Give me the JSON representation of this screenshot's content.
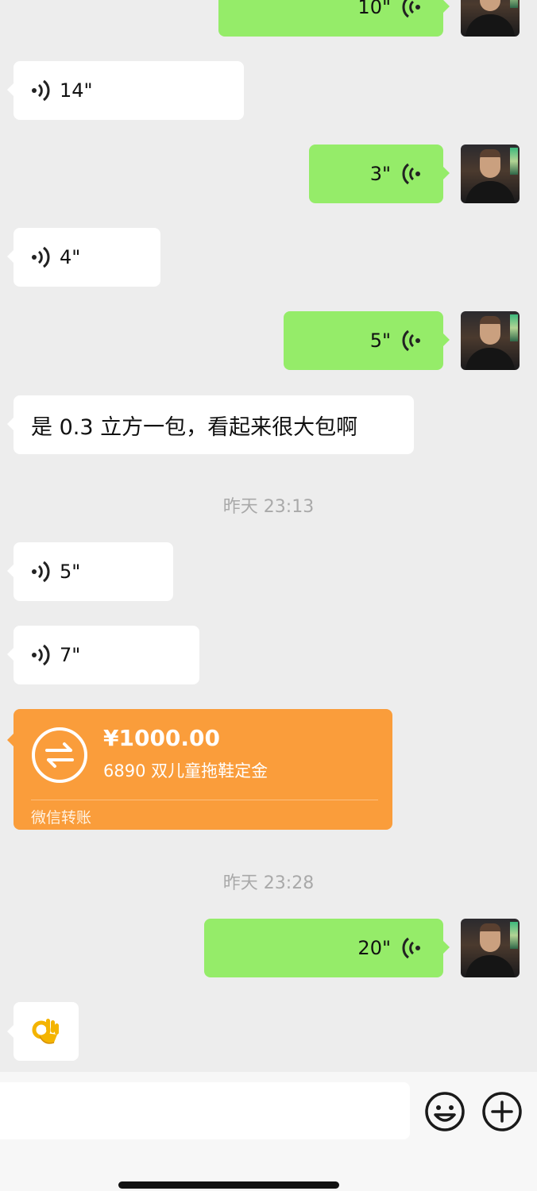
{
  "messages": [
    {
      "type": "voice",
      "side": "right",
      "duration": "10\""
    },
    {
      "type": "voice",
      "side": "left",
      "duration": "14\""
    },
    {
      "type": "voice",
      "side": "right",
      "duration": "3\""
    },
    {
      "type": "voice",
      "side": "left",
      "duration": "4\""
    },
    {
      "type": "voice",
      "side": "right",
      "duration": "5\""
    },
    {
      "type": "text",
      "side": "left",
      "text": "是 0.3 立方一包，看起来很大包啊"
    },
    {
      "type": "timestamp",
      "text": "昨天 23:13"
    },
    {
      "type": "voice",
      "side": "left",
      "duration": "5\""
    },
    {
      "type": "voice",
      "side": "left",
      "duration": "7\""
    },
    {
      "type": "transfer",
      "side": "left",
      "amount": "¥1000.00",
      "note": "6890 双儿童拖鞋定金",
      "footer": "微信转账"
    },
    {
      "type": "timestamp",
      "text": "昨天 23:28"
    },
    {
      "type": "voice",
      "side": "right",
      "duration": "20\""
    },
    {
      "type": "emoji",
      "side": "left",
      "icon": "ok-hand-emoji"
    }
  ],
  "input_bar": {
    "emoji_icon": "smiley-icon",
    "more_icon": "plus-icon"
  },
  "colors": {
    "background": "#ededed",
    "outgoing": "#95ec69",
    "incoming": "#ffffff",
    "transfer": "#fa9d3b"
  }
}
